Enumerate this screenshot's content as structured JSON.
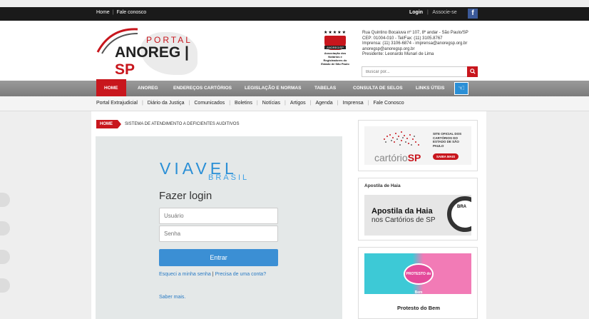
{
  "topbar": {
    "home": "Home",
    "contact": "Fale conosco",
    "login": "Login",
    "signup": "Associe-se",
    "facebook_glyph": "f"
  },
  "header": {
    "logo_portal": "PORTAL",
    "logo_name": "ANOREG",
    "logo_sp": "SP",
    "seal_stars": "★★★★★",
    "seal_badge": "ANOREG/SP",
    "seal_caption": "Associação dos Notários e Registradores do Estado de São Paulo",
    "address_lines": [
      "Rua Quintino Bocaiuva nº 107, 8º andar - São Paulo/SP",
      "CEP: 01004-010 - Tel/Fax: (11) 3105.8767",
      "Imprensa: (11) 3106-6874 - imprensa@anoregsp.org.br",
      "anoregsp@anoregsp.org.br",
      "Presidente: Leonardo Munari de Lima"
    ],
    "search_placeholder": "Buscar por..."
  },
  "nav": {
    "items": [
      "HOME",
      "ANOREG",
      "ENDEREÇOS CARTÓRIOS",
      "LEGISLAÇÃO E NORMAS",
      "TABELAS",
      "CONSULTA DE SELOS",
      "LINKS ÚTEIS"
    ],
    "active": "HOME",
    "accessibility_icon": "accessibility-icon"
  },
  "subnav": {
    "items": [
      "Portal Extrajudicial",
      "Diário da Justiça",
      "Comunicados",
      "Boletins",
      "Notícias",
      "Artigos",
      "Agenda",
      "Imprensa",
      "Fale Conosco"
    ]
  },
  "breadcrumb": {
    "home": "HOME",
    "current": "SISTEMA DE ATENDIMENTO A DEFICIENTES AUDITIVOS"
  },
  "login": {
    "brand_main": "VIAVEL",
    "brand_sub": "BRASIL",
    "title": "Fazer login",
    "user_placeholder": "Usuário",
    "password_placeholder": "Senha",
    "submit": "Entrar",
    "forgot": "Esqueci a minha senha",
    "help": "Precisa de uma conta?",
    "more": "Saber mais."
  },
  "sidebar": {
    "card1": {
      "word": "cartório",
      "sp": "SP",
      "tag": "SITE OFICIAL DOS CARTÓRIOS DO ESTADO DE SÃO PAULO",
      "button": "SAIBA MAIS"
    },
    "card2": {
      "title": "Apostila de Haia",
      "line1": "Apostila da Haia",
      "line2": "nos Cartórios de SP",
      "seal": "BRA"
    },
    "card3": {
      "badge": "PROTESTO do Bem",
      "title": "Protesto do Bem"
    }
  }
}
